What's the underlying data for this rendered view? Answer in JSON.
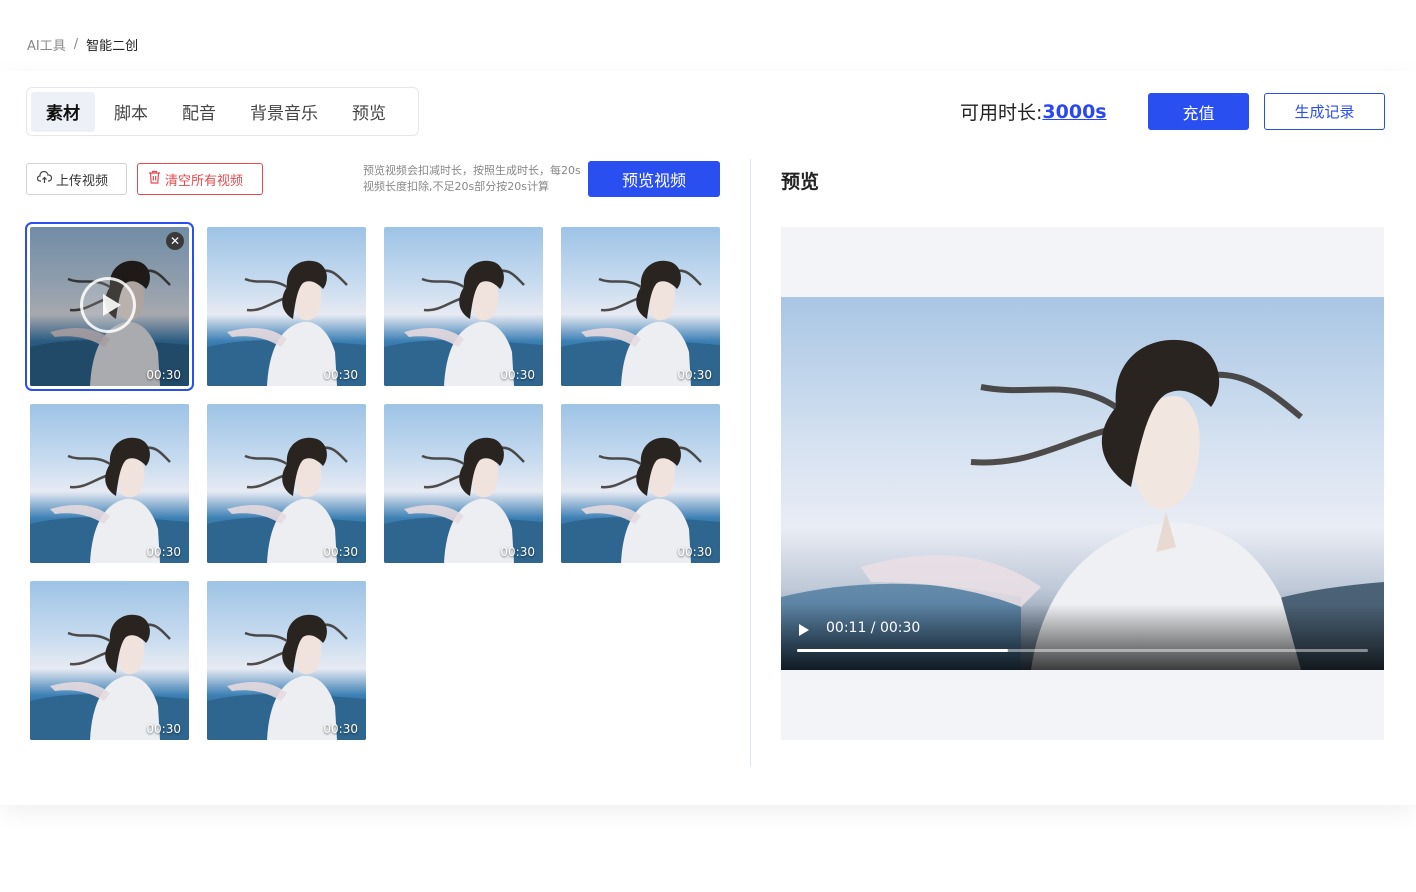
{
  "breadcrumb": {
    "root": "AI工具",
    "sep": "/",
    "current": "智能二创"
  },
  "tabs": [
    {
      "label": "素材",
      "active": true
    },
    {
      "label": "脚本",
      "active": false
    },
    {
      "label": "配音",
      "active": false
    },
    {
      "label": "背景音乐",
      "active": false
    },
    {
      "label": "预览",
      "active": false
    }
  ],
  "duration": {
    "label": "可用时长:",
    "value": "3000s"
  },
  "buttons": {
    "recharge": "充值",
    "history": "生成记录",
    "upload": "上传视频",
    "clear": "清空所有视频",
    "preview_video": "预览视频"
  },
  "hint": "预览视频会扣减时长，按照生成时长，每20s视频长度扣除,不足20s部分按20s计算",
  "thumbnails": [
    {
      "duration": "00:30",
      "selected": true
    },
    {
      "duration": "00:30",
      "selected": false
    },
    {
      "duration": "00:30",
      "selected": false
    },
    {
      "duration": "00:30",
      "selected": false
    },
    {
      "duration": "00:30",
      "selected": false
    },
    {
      "duration": "00:30",
      "selected": false
    },
    {
      "duration": "00:30",
      "selected": false
    },
    {
      "duration": "00:30",
      "selected": false
    },
    {
      "duration": "00:30",
      "selected": false
    },
    {
      "duration": "00:30",
      "selected": false
    }
  ],
  "preview": {
    "title": "预览",
    "time": "00:11 / 00:30",
    "progress": 0.37
  },
  "colors": {
    "accent": "#2a4ff0",
    "danger": "#e9484d"
  }
}
